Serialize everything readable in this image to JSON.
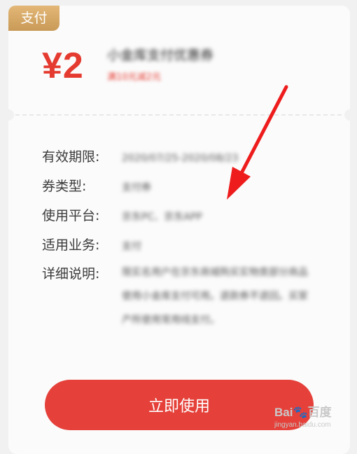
{
  "badge": {
    "label": "支付"
  },
  "coupon": {
    "price": "¥2",
    "name": "小金库支付优惠券",
    "subtitle": "满10元减2元"
  },
  "details": [
    {
      "label": "有效期限:",
      "value": "2020/07/25-2020/08/23"
    },
    {
      "label": "券类型:",
      "value": "支付券"
    },
    {
      "label": "使用平台:",
      "value": "京东PC、京东APP"
    },
    {
      "label": "适用业务:",
      "value": "支付"
    },
    {
      "label": "详细说明:",
      "value": "限实名用户在京东商城购买实物类部分商品使用小金库支付可用。退款券不退回。买家产所使用常用线支付。"
    }
  ],
  "button": {
    "label": "立即使用"
  },
  "watermark": {
    "logo": "Bai🐾百度",
    "url": "jingyan.baidu.com"
  },
  "colors": {
    "accent": "#e53a2f",
    "button": "#e5413a",
    "badge": "#d1a35f",
    "arrow": "#ee1c1c"
  }
}
